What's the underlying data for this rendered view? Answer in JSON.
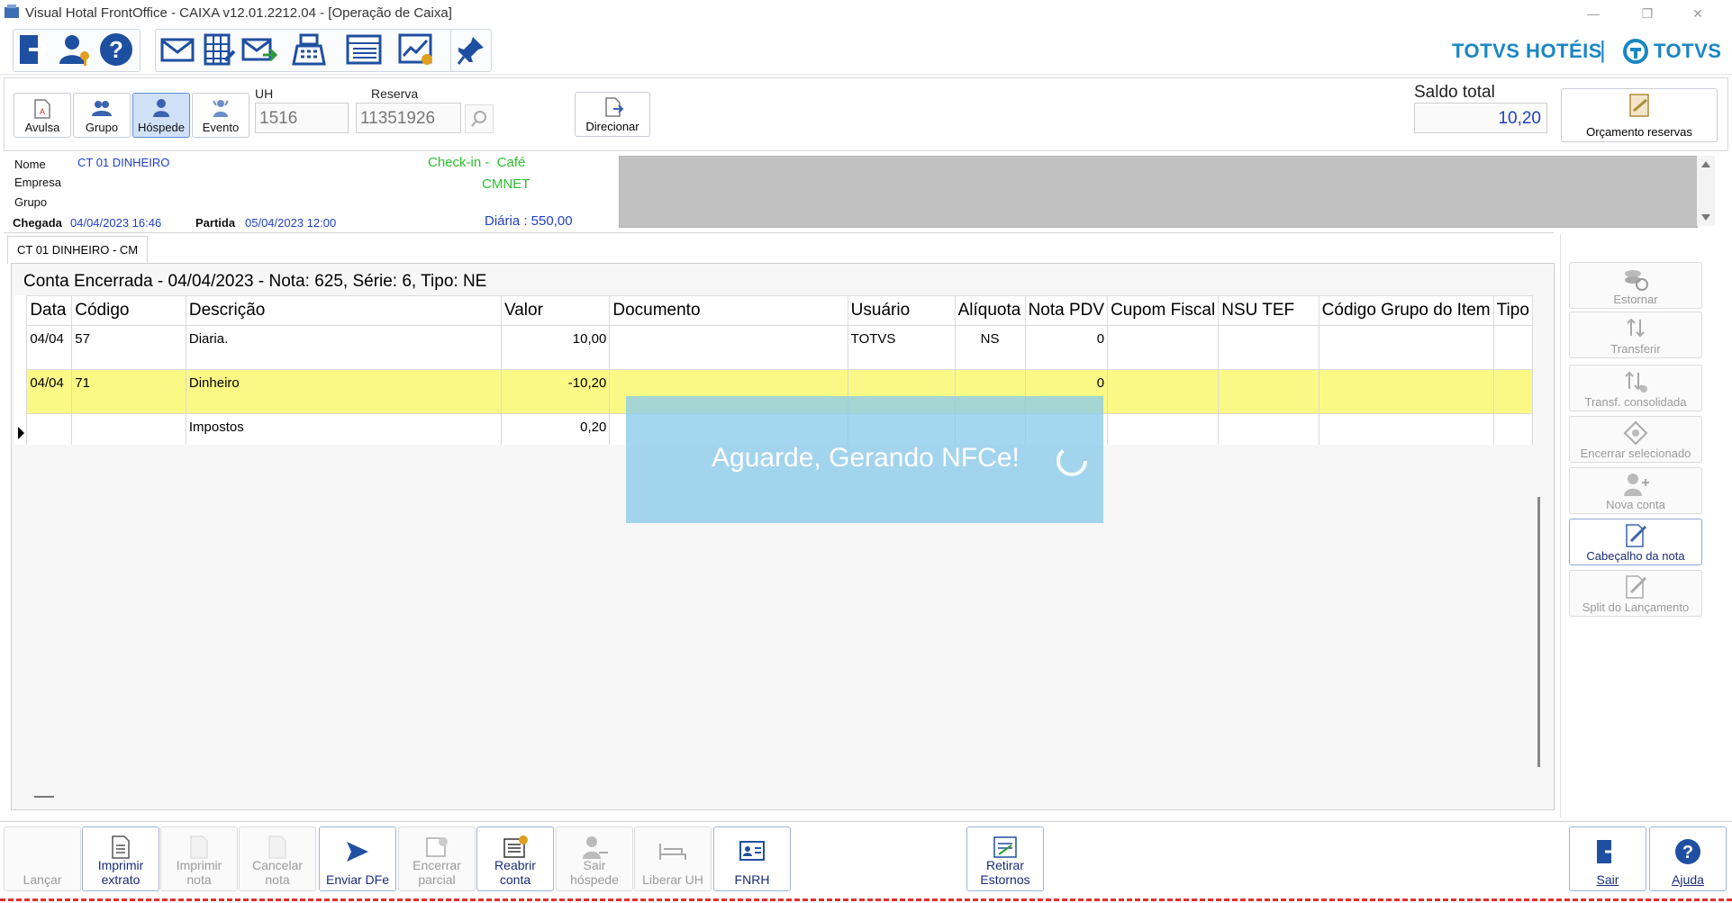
{
  "window": {
    "title": "Visual Hotal FrontOffice - CAIXA v12.01.2212.04 - [Operação de Caixa]",
    "minimize": "—",
    "restore": "❐",
    "close": "✕"
  },
  "brand": {
    "hotels": "TOTVS HOTÉIS",
    "separator": "|",
    "totvs": "TOTVS"
  },
  "modes": [
    {
      "label": "Avulsa"
    },
    {
      "label": "Grupo"
    },
    {
      "label": "Hóspede"
    },
    {
      "label": "Evento"
    }
  ],
  "uh": {
    "label": "UH",
    "value": "1516"
  },
  "reserva": {
    "label": "Reserva",
    "value": "11351926"
  },
  "direcionar": "Direcionar",
  "saldo": {
    "label": "Saldo total",
    "value": "10,20"
  },
  "orcamento": "Orçamento reservas",
  "guest": {
    "nome_label": "Nome",
    "nome": "CT 01 DINHEIRO",
    "empresa_label": "Empresa",
    "grupo_label": "Grupo",
    "chegada_label": "Chegada",
    "chegada": "04/04/2023 16:46",
    "partida_label": "Partida",
    "partida": "05/04/2023 12:00",
    "checkin": "Check-in -  Café",
    "cmnet": "CMNET",
    "diaria": "Diária : 550,00"
  },
  "tab": "CT 01 DINHEIRO - CM",
  "account_title": "Conta Encerrada - 04/04/2023 - Nota: 625, Série: 6, Tipo: NE",
  "columns": [
    "Data",
    "Código",
    "Descrição",
    "Valor",
    "Documento",
    "Usuário",
    "Alíquota",
    "Nota PDV",
    "Cupom Fiscal",
    "NSU TEF",
    "Código Grupo do Item",
    "Tipo"
  ],
  "rows": [
    {
      "data": "04/04",
      "codigo": "57",
      "descricao": "Diaria.",
      "valor": "10,00",
      "documento": "",
      "usuario": "TOTVS",
      "aliquota": "NS",
      "nota_pdv": "0",
      "cupom": "",
      "nsu": "",
      "grupo": "",
      "tipo": ""
    },
    {
      "data": "04/04",
      "codigo": "71",
      "descricao": "Dinheiro",
      "valor": "-10,20",
      "documento": "",
      "usuario": "",
      "aliquota": "",
      "nota_pdv": "0",
      "cupom": "",
      "nsu": "",
      "grupo": "",
      "tipo": ""
    },
    {
      "data": "",
      "codigo": "",
      "descricao": "Impostos",
      "valor": "0,20",
      "documento": "",
      "usuario": "",
      "aliquota": "",
      "nota_pdv": "",
      "cupom": "",
      "nsu": "",
      "grupo": "",
      "tipo": ""
    }
  ],
  "overlay": "Aguarde, Gerando NFCe!",
  "side_actions": [
    {
      "label": "Estornar"
    },
    {
      "label": "Transferir"
    },
    {
      "label": "Transf. consolidada"
    },
    {
      "label": "Encerrar selecionado"
    },
    {
      "label": "Nova conta"
    },
    {
      "label": "Cabeçalho da nota"
    },
    {
      "label": "Split do Lançamento"
    }
  ],
  "bottom_actions": [
    {
      "label": "Lançar"
    },
    {
      "label": "Imprimir extrato"
    },
    {
      "label": "Imprimir nota"
    },
    {
      "label": "Cancelar nota"
    },
    {
      "label": "Enviar DFe"
    },
    {
      "label": "Encerrar parcial"
    },
    {
      "label": "Reabrir conta"
    },
    {
      "label": "Sair hóspede"
    },
    {
      "label": "Liberar UH"
    },
    {
      "label": "FNRH"
    },
    {
      "label": "Retirar Estornos"
    },
    {
      "label": "Sair"
    },
    {
      "label": "Ajuda"
    }
  ]
}
